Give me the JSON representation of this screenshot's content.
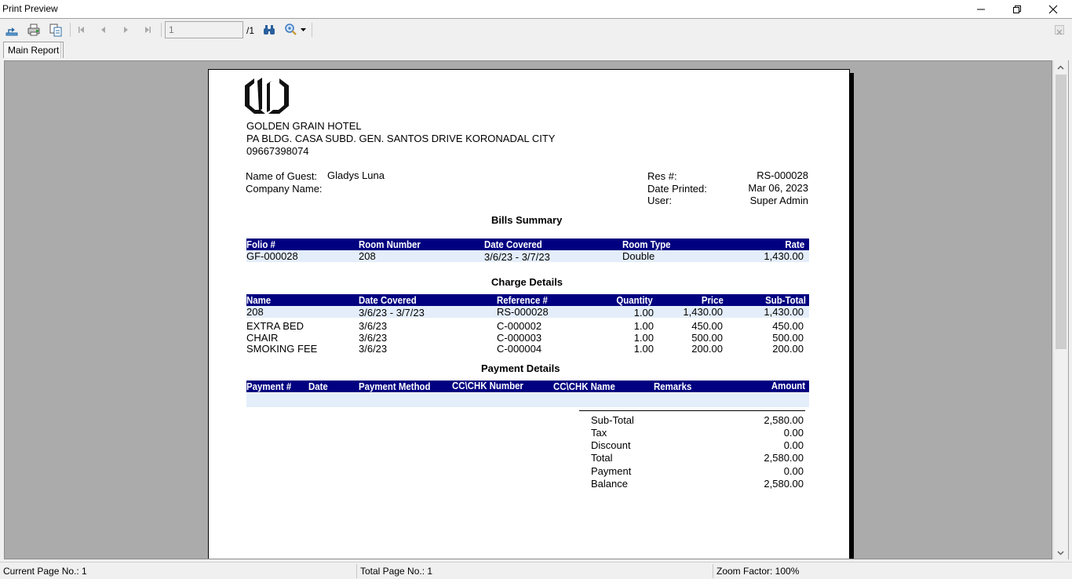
{
  "window": {
    "title": "Print Preview",
    "controls": {
      "minimize": "minimize",
      "maximize": "restore",
      "close": "close"
    }
  },
  "toolbar": {
    "icons": [
      "export-icon",
      "print-icon",
      "copy-icon",
      "first-page-icon",
      "prev-page-icon",
      "next-page-icon",
      "last-page-icon",
      "find-icon",
      "zoom-icon"
    ],
    "current_page": "1",
    "total_pages": "/1"
  },
  "tabs": [
    {
      "label": "Main Report",
      "active": true
    }
  ],
  "report": {
    "hotel": {
      "name": "GOLDEN GRAIN HOTEL",
      "address": "PA BLDG. CASA SUBD. GEN. SANTOS DRIVE KORONADAL CITY",
      "phone": "09667398074"
    },
    "guest": {
      "name_label": "Name of Guest:",
      "name_value": "Gladys Luna",
      "company_label": "Company Name:",
      "company_value": ""
    },
    "meta": {
      "res_label": "Res #:",
      "res_value": "RS-000028",
      "date_label": "Date Printed:",
      "date_value": "Mar 06, 2023",
      "user_label": "User:",
      "user_value": "Super Admin"
    },
    "bills_summary": {
      "title": "Bills Summary",
      "columns": [
        "Folio #",
        "Room Number",
        "Date Covered",
        "Room Type",
        "Rate"
      ],
      "rows": [
        [
          "GF-000028",
          "208",
          "3/6/23 - 3/7/23",
          "Double",
          "1,430.00"
        ]
      ]
    },
    "charge_details": {
      "title": "Charge Details",
      "columns": [
        "Name",
        "Date Covered",
        "Reference #",
        "Quantity",
        "Price",
        "Sub-Total"
      ],
      "rows": [
        [
          "208",
          "3/6/23 - 3/7/23",
          "RS-000028",
          "1.00",
          "1,430.00",
          "1,430.00"
        ],
        [
          "EXTRA BED",
          "3/6/23",
          "C-000002",
          "1.00",
          "450.00",
          "450.00"
        ],
        [
          "CHAIR",
          "3/6/23",
          "C-000003",
          "1.00",
          "500.00",
          "500.00"
        ],
        [
          "SMOKING FEE",
          "3/6/23",
          "C-000004",
          "1.00",
          "200.00",
          "200.00"
        ]
      ]
    },
    "payment_details": {
      "title": "Payment Details",
      "columns": [
        "Payment #",
        "Date",
        "Payment Method",
        "CC\\CHK Number",
        "CC\\CHK Name",
        "Remarks",
        "Amount"
      ],
      "rows": []
    },
    "totals": [
      {
        "label": "Sub-Total",
        "value": "2,580.00"
      },
      {
        "label": "Tax",
        "value": "0.00"
      },
      {
        "label": "Discount",
        "value": "0.00"
      },
      {
        "label": "Total",
        "value": "2,580.00"
      },
      {
        "label": "Payment",
        "value": "0.00"
      },
      {
        "label": "Balance",
        "value": "2,580.00"
      }
    ]
  },
  "status": {
    "current_page": "Current Page No.: 1",
    "total_page": "Total Page No.: 1",
    "zoom": "Zoom Factor: 100%"
  },
  "colors": {
    "header_bar": "#000080",
    "row_band": "#e4eefa",
    "viewer_bg": "#ababab"
  }
}
